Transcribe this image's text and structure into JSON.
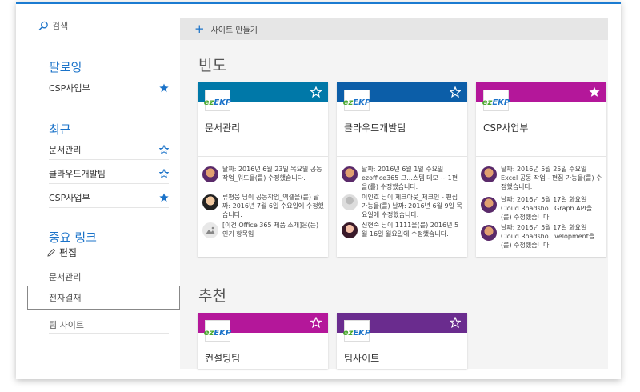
{
  "search": {
    "label": "검색"
  },
  "following": {
    "title": "팔로잉",
    "items": [
      {
        "label": "CSP사업부",
        "starred": true
      }
    ]
  },
  "recent": {
    "title": "최근",
    "items": [
      {
        "label": "문서관리",
        "starred": false
      },
      {
        "label": "클라우드개발팀",
        "starred": false
      },
      {
        "label": "CSP사업부",
        "starred": true
      }
    ]
  },
  "important_links": {
    "title": "중요 링크",
    "edit_label": "편집",
    "items": [
      {
        "label": "문서관리"
      },
      {
        "label": "전자결재"
      },
      {
        "label": "팀 사이트"
      }
    ]
  },
  "toolbar": {
    "create_site_label": "사이트 만들기"
  },
  "frequent": {
    "heading": "빈도",
    "cards": [
      {
        "title": "문서관리",
        "band_color": "#0078a8",
        "starred": false,
        "activities": [
          {
            "text": "날짜: 2016년 6월 23일 목요일 공동작업_워드을(를) 수정했습니다.",
            "avatar": "person-a"
          },
          {
            "text": "류평웅 님이 공동작업_엑셀을(를) 날짜: 2016년 7월 6일 수요일에 수정했습니다.",
            "avatar": "person-b"
          },
          {
            "text": "[이건 Office 365 제품 소개]은(는) 인기 항목임",
            "avatar": "image"
          }
        ]
      },
      {
        "title": "클라우드개발팀",
        "band_color": "#0c5ea8",
        "starred": false,
        "activities": [
          {
            "text_bold": "ezoffice365",
            "text": "날짜: 2016년 6월 1일 수요일 ezoffice365 그...스템 데모 ~ 1편을(를) 수정했습니다.",
            "avatar": "person-a"
          },
          {
            "text": "이인호 님이 체크아웃_체크인 - 편집 가능을(를) 날짜: 2016년 6월 9일 목요일에 수정했습니다.",
            "avatar": "placeholder"
          },
          {
            "text": "신현숙 님이 1111을(를) 2016년 5월 16일 월요일에 수정했습니다.",
            "avatar": "person-c"
          }
        ]
      },
      {
        "title": "CSP사업부",
        "band_color": "#b4179a",
        "starred": true,
        "activities": [
          {
            "text": "날짜: 2016년 5월 25일 수요일 Excel 공동 작업 - 편집 가능을(를) 수정했습니다.",
            "avatar": "person-a"
          },
          {
            "text": "날짜: 2016년 5월 17일 화요일 Cloud Roadsho...Graph API을(를) 수정했습니다.",
            "avatar": "person-a"
          },
          {
            "text": "날짜: 2016년 5월 17일 화요일 Cloud Roadsho...velopment을(를) 수정했습니다.",
            "avatar": "person-a"
          }
        ]
      }
    ]
  },
  "recommended": {
    "heading": "추천",
    "cards": [
      {
        "title": "컨설팅팀",
        "band_color": "#b4179a",
        "starred": false
      },
      {
        "title": "팀사이트",
        "band_color": "#6a2c8e",
        "starred": false
      }
    ]
  },
  "logo": {
    "text_ez": "ez",
    "text_ekp": "EKP"
  }
}
